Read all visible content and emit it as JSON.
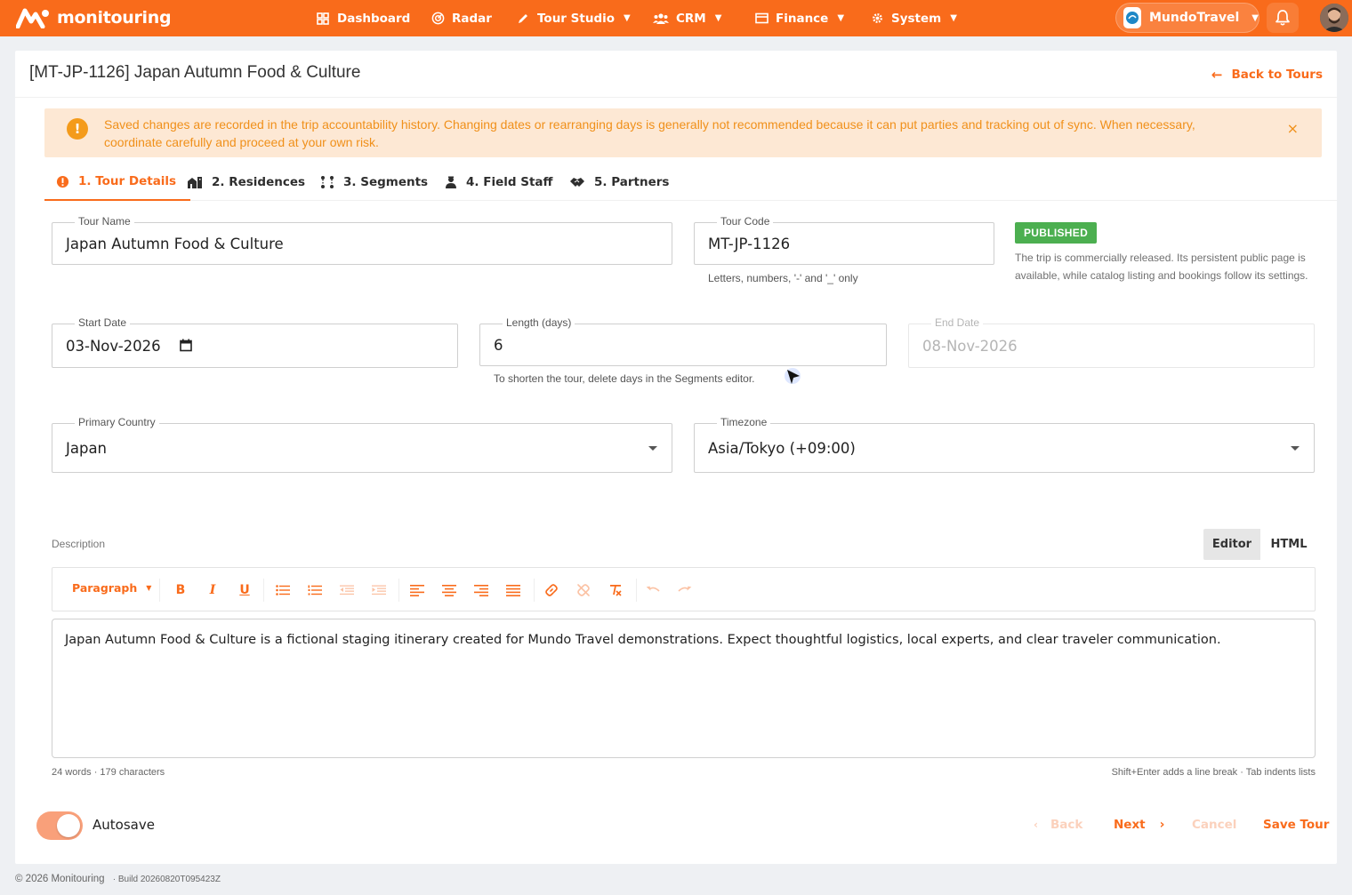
{
  "app": {
    "name": "monitouring"
  },
  "nav": {
    "items": [
      {
        "label": "Dashboard",
        "icon": "dashboard-icon"
      },
      {
        "label": "Radar",
        "icon": "radar-icon"
      },
      {
        "label": "Tour Studio",
        "icon": "pen-icon"
      },
      {
        "label": "CRM",
        "icon": "people-icon"
      },
      {
        "label": "Finance",
        "icon": "wallet-icon"
      },
      {
        "label": "System",
        "icon": "gear-icon"
      }
    ],
    "org": "MundoTravel"
  },
  "page": {
    "title": "[MT-JP-1126] Japan Autumn Food & Culture",
    "back_label": "Back to Tours",
    "alert": "Saved changes are recorded in the trip accountability history. Changing dates or rearranging days is generally not recommended because it can put parties and tracking out of sync. When necessary, coordinate carefully and proceed at your own risk.",
    "alert_close": "×"
  },
  "tabs": [
    {
      "label": "1. Tour Details",
      "active": true
    },
    {
      "label": "2. Residences"
    },
    {
      "label": "3. Segments"
    },
    {
      "label": "4. Field Staff"
    },
    {
      "label": "5. Partners"
    }
  ],
  "form": {
    "tour_name": {
      "label": "Tour Name",
      "value": "Japan Autumn Food & Culture"
    },
    "tour_code": {
      "label": "Tour Code",
      "value": "MT-JP-1126",
      "helper": "Letters, numbers, '-' and '_' only"
    },
    "status": {
      "badge": "PUBLISHED",
      "description": "The trip is commercially released. Its persistent public page is available, while catalog listing and bookings follow its settings.",
      "color": "#4caf50"
    },
    "start_date": {
      "label": "Start Date",
      "value": "03-Nov-2026"
    },
    "length": {
      "label": "Length (days)",
      "value": "6",
      "helper": "To shorten the tour, delete days in the Segments editor."
    },
    "end_date": {
      "label": "End Date",
      "value": "08-Nov-2026"
    },
    "country": {
      "label": "Primary Country",
      "value": "Japan"
    },
    "timezone": {
      "label": "Timezone",
      "value": "Asia/Tokyo (+09:00)"
    }
  },
  "description": {
    "label": "Description",
    "modes": [
      "Editor",
      "HTML"
    ],
    "active_mode": "Editor",
    "paragraph_label": "Paragraph",
    "content": "Japan Autumn Food & Culture is a fictional staging itinerary created for Mundo Travel demonstrations. Expect thoughtful logistics, local experts, and clear traveler communication.",
    "counts": "24 words · 179 characters",
    "hint": "Shift+Enter adds a line break · Tab indents lists"
  },
  "footer_actions": {
    "autosave_label": "Autosave",
    "autosave_on": true,
    "back": "Back",
    "next": "Next",
    "cancel": "Cancel",
    "save": "Save Tour"
  },
  "footer": {
    "copyright": "© 2026 Monitouring",
    "build": "· Build 20260820T095423Z"
  },
  "colors": {
    "brand": "#f96b1b",
    "alert_bg": "#fde8d4",
    "alert_text": "#f0901a",
    "published": "#4caf50"
  }
}
